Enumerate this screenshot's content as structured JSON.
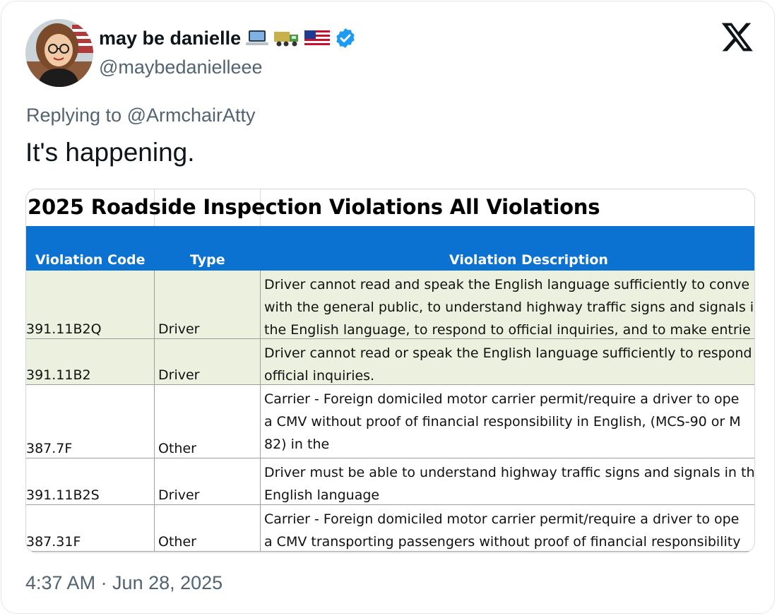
{
  "tweet": {
    "display_name": "may be danielle",
    "name_emojis": [
      "laptop-emoji",
      "truck-emoji",
      "us-flag-emoji"
    ],
    "verified": true,
    "handle": "@maybedanielleee",
    "replying_to": "Replying to @ArmchairAtty",
    "text": "It's happening.",
    "timestamp": "4:37 AM · Jun 28, 2025",
    "accent_color": "#1d9bf0"
  },
  "sheet": {
    "title": "2025 Roadside Inspection Violations All Violations",
    "header_color": "#0b72d1",
    "alt_row_color": "#ebf1de",
    "columns": [
      "Violation Code",
      "Type",
      "Violation Description"
    ],
    "rows": [
      {
        "code": "391.11B2Q",
        "type": "Driver",
        "description": [
          "Driver cannot read and speak the English language sufficiently to conve",
          "with the general public, to understand highway traffic signs and signals i",
          "the English language, to respond to official inquiries, and to make entrie"
        ]
      },
      {
        "code": "391.11B2",
        "type": "Driver",
        "description": [
          "Driver cannot read or speak the English language sufficiently to respond",
          "official inquiries."
        ]
      },
      {
        "code": "387.7F",
        "type": "Other",
        "description": [
          "Carrier - Foreign domiciled motor carrier permit/require a driver to ope",
          "a CMV without proof of financial responsibility in English, (MCS-90 or M",
          "82) in the"
        ]
      },
      {
        "code": "391.11B2S",
        "type": "Driver",
        "description": [
          "Driver must be able to understand highway traffic signs and signals in th",
          "English language"
        ]
      },
      {
        "code": "387.31F",
        "type": "Other",
        "description": [
          "Carrier - Foreign domiciled motor carrier permit/require a driver to ope",
          "a CMV transporting passengers without proof of financial responsibility"
        ]
      }
    ]
  }
}
